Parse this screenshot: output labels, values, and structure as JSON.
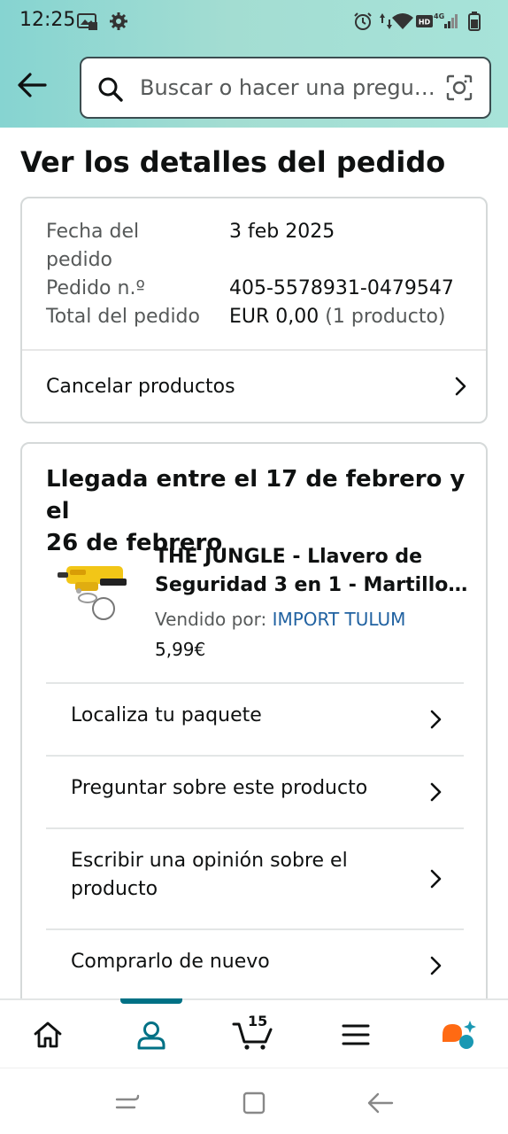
{
  "status_bar": {
    "time": "12:25",
    "icons": [
      "photo-icon",
      "settings-gear-icon",
      "alarm-icon",
      "data-arrows-icon",
      "wifi-icon",
      "hd-badge-icon",
      "signal-4g-icon",
      "battery-icon"
    ],
    "hd_label": "HD",
    "network_label": "4G"
  },
  "header": {
    "search_placeholder": "Buscar o hacer una pregu…"
  },
  "page": {
    "title": "Ver los detalles del pedido"
  },
  "summary": {
    "date_label_line1": "Fecha del",
    "date_label_line2": "pedido",
    "date_value": "3 feb 2025",
    "order_label": "Pedido n.º",
    "order_value": "405-5578931-0479547",
    "total_label": "Total del pedido",
    "total_value": "EUR 0,00",
    "total_count": "(1 producto)",
    "cancel_label": "Cancelar productos"
  },
  "shipment": {
    "arrival_line1": "Llegada entre el 17 de febrero y el",
    "arrival_line2": "26 de febrero",
    "product_title_line1": "THE JUNGLE - Llavero de",
    "product_title_line2": "Seguridad 3 en 1 - Martillo R...",
    "seller_label": "Vendido por:",
    "seller_name": "IMPORT TULUM",
    "price": "5,99€",
    "actions": {
      "track": "Localiza tu paquete",
      "ask": "Preguntar sobre este producto",
      "review_line1": "Escribir una opinión sobre el",
      "review_line2": "producto",
      "buy_again": "Comprarlo de nuevo"
    }
  },
  "bottom_nav": {
    "cart_count": "15",
    "active": "account",
    "accent_color": "#007185",
    "items": [
      "home-icon",
      "account-icon",
      "cart-icon",
      "menu-icon",
      "rufus-assistant-icon"
    ]
  },
  "colors": {
    "header_start": "#86d4d1",
    "header_end": "#a7e3d9",
    "link": "#2162a1",
    "assistant_orange": "#ff6a13",
    "assistant_teal": "#1a98b3"
  }
}
